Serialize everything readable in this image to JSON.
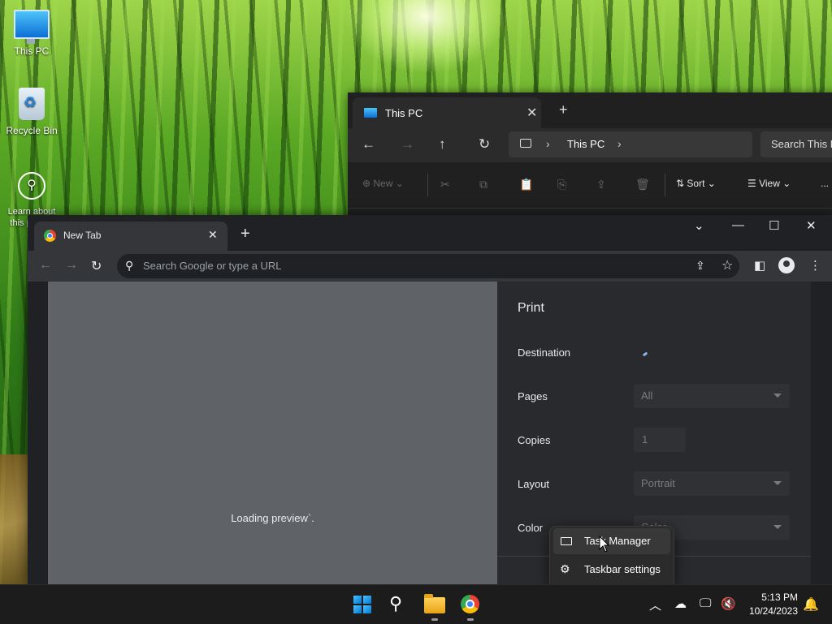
{
  "desktop": {
    "icons": [
      {
        "label": "This PC"
      },
      {
        "label": "Recycle Bin"
      },
      {
        "label": "Learn about this picture"
      }
    ]
  },
  "explorer": {
    "tab_title": "This PC",
    "breadcrumb": "This PC",
    "search_placeholder": "Search This PC",
    "toolbar": {
      "new_label": "New",
      "sort_label": "Sort",
      "view_label": "View",
      "more_label": "..."
    }
  },
  "chrome": {
    "tab_title": "New Tab",
    "omnibox_placeholder": "Search Google or type a URL",
    "print": {
      "title": "Print",
      "loading_text": "Loading preview`.",
      "rows": [
        {
          "label": "Destination"
        },
        {
          "label": "Pages",
          "value": "All"
        },
        {
          "label": "Copies",
          "value": "1"
        },
        {
          "label": "Layout",
          "value": "Portrait"
        },
        {
          "label": "Color",
          "value": "Color"
        }
      ]
    }
  },
  "context_menu": {
    "items": [
      {
        "label": "Task Manager",
        "icon": "task-manager-icon"
      },
      {
        "label": "Taskbar settings",
        "icon": "gear-icon"
      }
    ]
  },
  "taskbar": {
    "time": "5:13 PM",
    "date": "10/24/2023",
    "apps": [
      "start",
      "search",
      "file-explorer",
      "chrome"
    ]
  },
  "colors": {
    "accent": "#0078d4",
    "chrome_frame": "#202124",
    "print_panel": "#292a2d",
    "preview_bg": "#5f6368"
  }
}
